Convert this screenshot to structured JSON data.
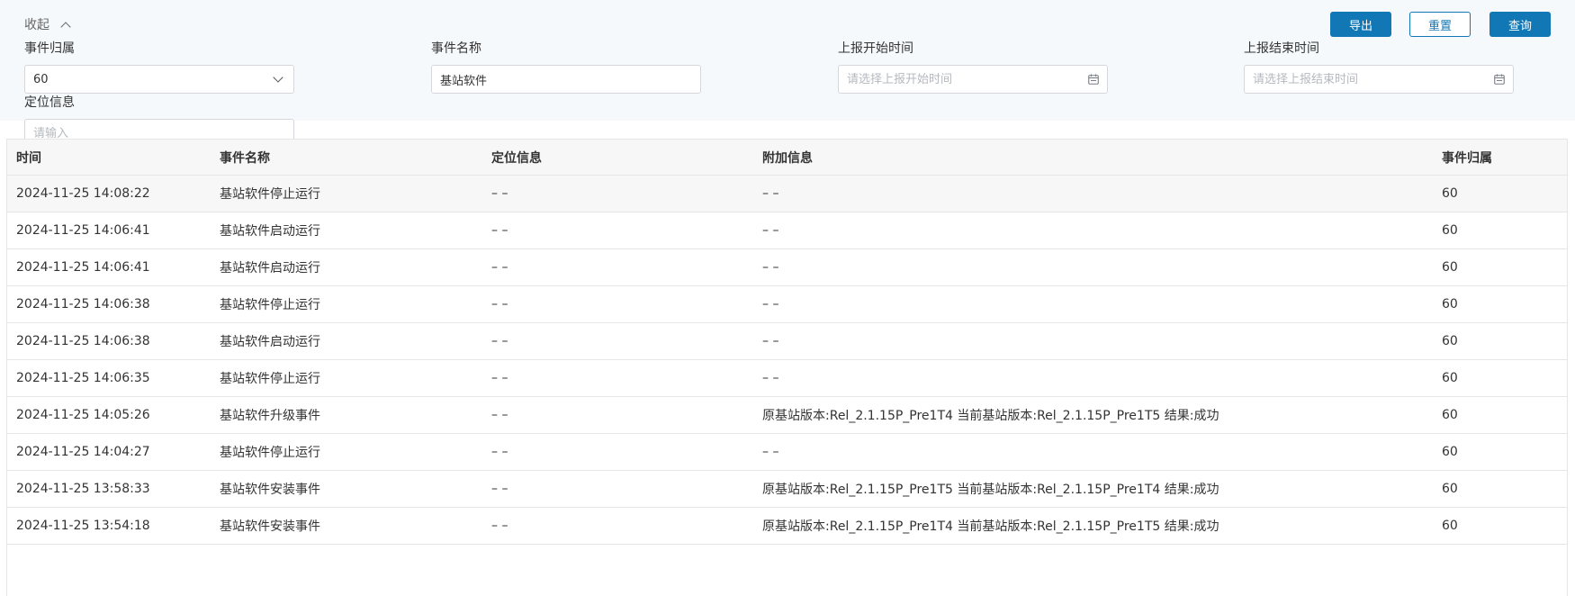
{
  "filter": {
    "collapse_label": "收起",
    "buttons": {
      "export": "导出",
      "reset": "重置",
      "query": "查询"
    },
    "event_owner": {
      "label": "事件归属",
      "value": "60"
    },
    "event_name": {
      "label": "事件名称",
      "value": "基站软件"
    },
    "report_start": {
      "label": "上报开始时间",
      "placeholder": "请选择上报开始时间"
    },
    "report_end": {
      "label": "上报结束时间",
      "placeholder": "请选择上报结束时间"
    },
    "location": {
      "label": "定位信息",
      "placeholder": "请输入"
    }
  },
  "table": {
    "columns": {
      "time": "时间",
      "name": "事件名称",
      "location": "定位信息",
      "extra": "附加信息",
      "owner": "事件归属"
    },
    "rows": [
      {
        "time": "2024-11-25 14:08:22",
        "name": "基站软件停止运行",
        "location": "– –",
        "extra": "– –",
        "owner": "60"
      },
      {
        "time": "2024-11-25 14:06:41",
        "name": "基站软件启动运行",
        "location": "– –",
        "extra": "– –",
        "owner": "60"
      },
      {
        "time": "2024-11-25 14:06:41",
        "name": "基站软件启动运行",
        "location": "– –",
        "extra": "– –",
        "owner": "60"
      },
      {
        "time": "2024-11-25 14:06:38",
        "name": "基站软件停止运行",
        "location": "– –",
        "extra": "– –",
        "owner": "60"
      },
      {
        "time": "2024-11-25 14:06:38",
        "name": "基站软件启动运行",
        "location": "– –",
        "extra": "– –",
        "owner": "60"
      },
      {
        "time": "2024-11-25 14:06:35",
        "name": "基站软件停止运行",
        "location": "– –",
        "extra": "– –",
        "owner": "60"
      },
      {
        "time": "2024-11-25 14:05:26",
        "name": "基站软件升级事件",
        "location": "– –",
        "extra": "原基站版本:Rel_2.1.15P_Pre1T4 当前基站版本:Rel_2.1.15P_Pre1T5 结果:成功",
        "owner": "60"
      },
      {
        "time": "2024-11-25 14:04:27",
        "name": "基站软件停止运行",
        "location": "– –",
        "extra": "– –",
        "owner": "60"
      },
      {
        "time": "2024-11-25 13:58:33",
        "name": "基站软件安装事件",
        "location": "– –",
        "extra": "原基站版本:Rel_2.1.15P_Pre1T5 当前基站版本:Rel_2.1.15P_Pre1T4 结果:成功",
        "owner": "60"
      },
      {
        "time": "2024-11-25 13:54:18",
        "name": "基站软件安装事件",
        "location": "– –",
        "extra": "原基站版本:Rel_2.1.15P_Pre1T4 当前基站版本:Rel_2.1.15P_Pre1T5 结果:成功",
        "owner": "60"
      }
    ]
  }
}
